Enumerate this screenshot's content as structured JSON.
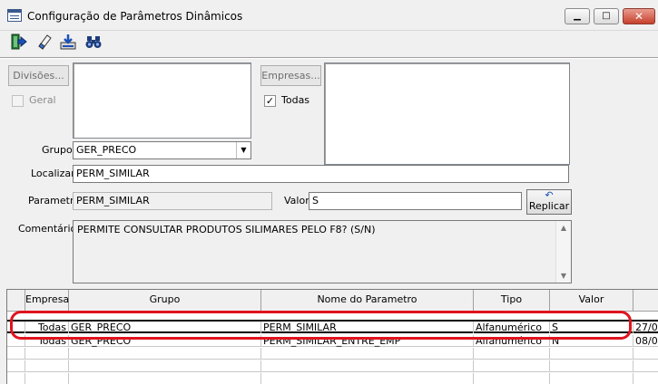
{
  "window": {
    "title": "Configuração de Parâmetros Dinâmicos",
    "minimize": "▁",
    "maximize": "□",
    "close": "✕"
  },
  "toolbar": {
    "icons": [
      "exit-icon",
      "eraser-icon",
      "download-icon",
      "binoculars-icon"
    ]
  },
  "form": {
    "divisoes_button": "Divisões...",
    "geral_label": "Geral",
    "empresas_button": "Empresas...",
    "todas_label": "Todas",
    "todas_checked": "✓",
    "grupo_label": "Grupo",
    "grupo_value": "GER_PRECO",
    "localizar_label": "Localizar",
    "localizar_value": "PERM_SIMILAR",
    "parametro_label": "Parametro",
    "parametro_value": "PERM_SIMILAR",
    "valor_label": "Valor",
    "valor_value": "S",
    "replicar_button": "Replicar",
    "comentarios_label": "Comentários",
    "comentarios_value": "PERMITE CONSULTAR PRODUTOS SILIMARES PELO F8? (S/N)"
  },
  "grid": {
    "columns": [
      "Empresa",
      "Grupo",
      "Nome do Parametro",
      "Tipo",
      "Valor"
    ],
    "rows": [
      {
        "empresa": "Todas",
        "grupo": "GER_PRECO",
        "nome": "PERM_SIMILAR",
        "tipo": "Alfanumérico",
        "valor": "S",
        "extra": "27/0"
      },
      {
        "empresa": "Todas",
        "grupo": "GER_PRECO",
        "nome": "PERM_SIMILAR_ENTRE_EMP",
        "tipo": "Alfanumérico",
        "valor": "N",
        "extra": "08/0"
      }
    ]
  },
  "colors": {
    "highlight": "#e0141e"
  }
}
